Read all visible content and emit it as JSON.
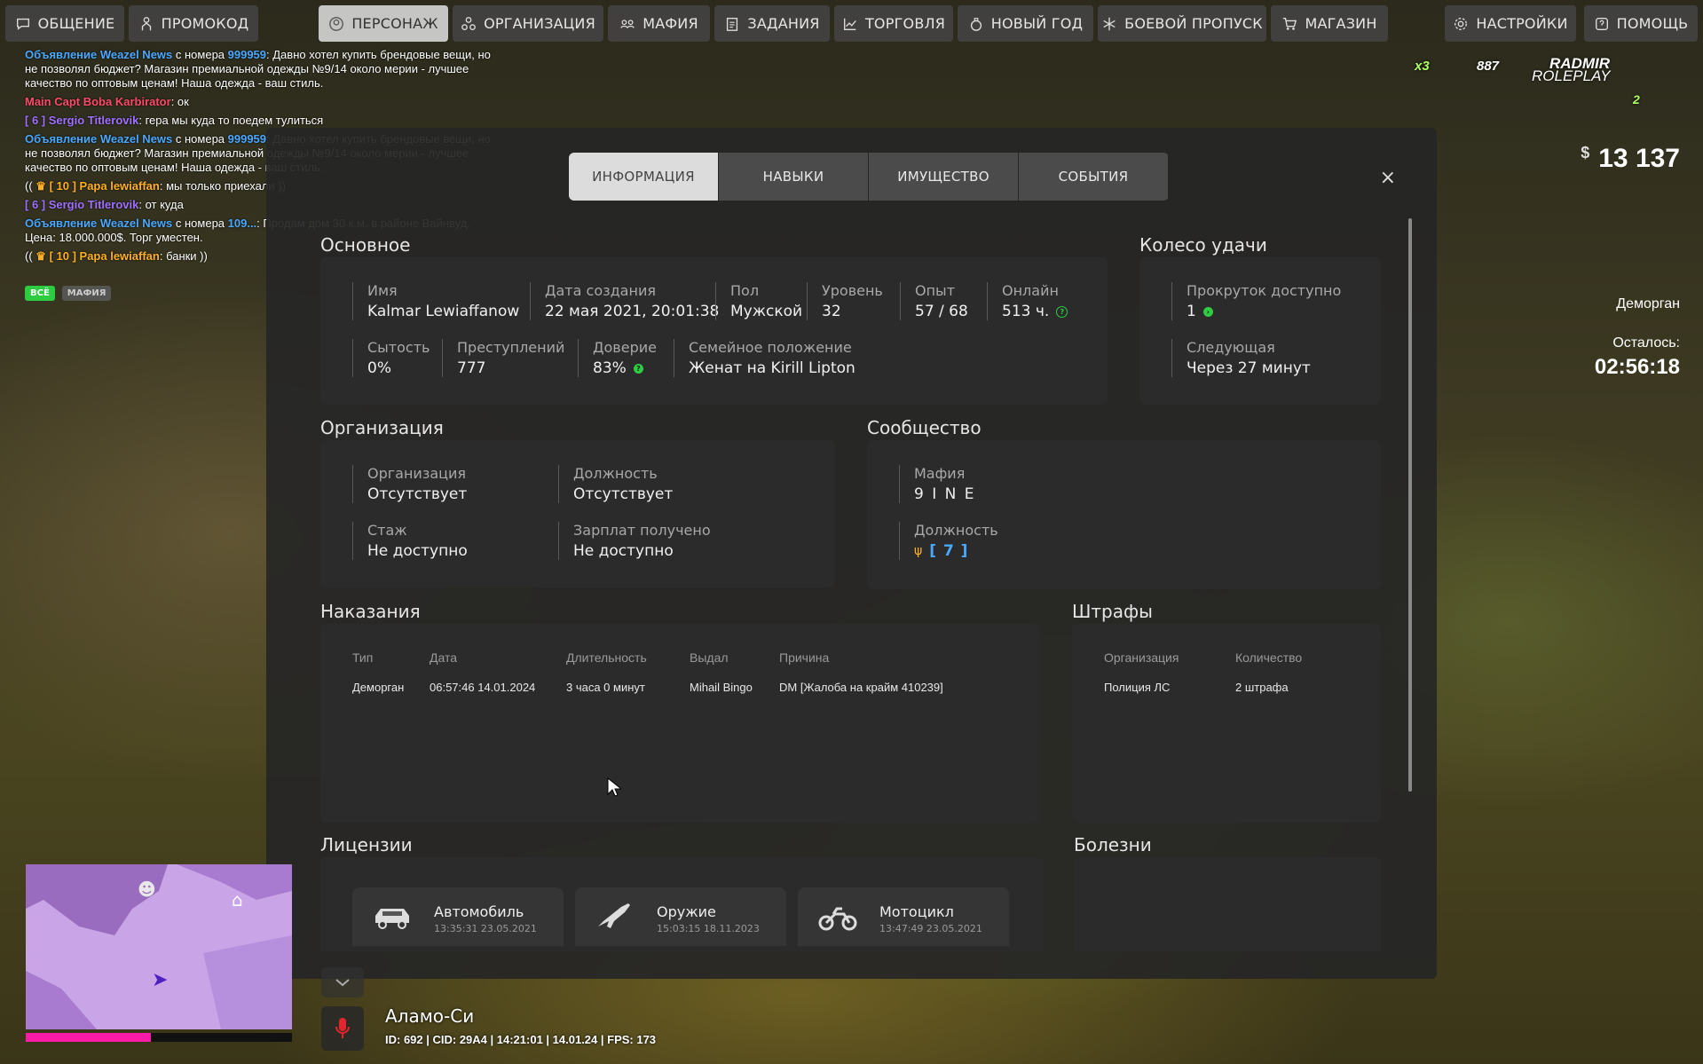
{
  "nav": {
    "left": [
      {
        "label": "ОБЩЕНИЕ",
        "icon": "chat-icon"
      },
      {
        "label": "ПРОМОКОД",
        "icon": "person-icon"
      },
      {
        "label": "ПЕРСОНАЖ",
        "icon": "user-circle-icon",
        "active": true
      },
      {
        "label": "ОРГАНИЗАЦИЯ",
        "icon": "network-icon"
      },
      {
        "label": "МАФИЯ",
        "icon": "group-icon"
      },
      {
        "label": "ЗАДАНИЯ",
        "icon": "clipboard-icon"
      },
      {
        "label": "ТОРГОВЛЯ",
        "icon": "chart-icon"
      },
      {
        "label": "НОВЫЙ ГОД",
        "icon": "ornament-icon"
      },
      {
        "label": "БОЕВОЙ ПРОПУСК",
        "icon": "snowflake-icon"
      },
      {
        "label": "МАГАЗИН",
        "icon": "cart-icon"
      }
    ],
    "right": [
      {
        "label": "НАСТРОЙКИ",
        "icon": "gear-icon"
      },
      {
        "label": "ПОМОЩЬ",
        "icon": "help-icon"
      }
    ]
  },
  "chat": {
    "lines": [
      {
        "prefix": "Объявление Weazel News",
        "mid": " с номера ",
        "num": "999959",
        "text": ": Давно хотел купить брендовые вещи, но не позволял бюджет? Магазин премиальной одежды №9/14 около мерии - лучшее качество по оптовым ценам! Наша одежда - ваш стиль."
      },
      {
        "name": "Main Capt Boba Karbirator",
        "text": ": ок",
        "color": "red"
      },
      {
        "name": "[ 6 ] Sergio Titlerovik",
        "text": ": гера мы куда то поедем тулиться",
        "color": "purple"
      },
      {
        "prefix": "Объявление Weazel News",
        "mid": " с номера ",
        "num": "999959",
        "text": ": Давно хотел купить брендовые вещи, но не позволял бюджет? Магазин премиальной одежды №9/14 около мерии - лучшее качество по оптовым ценам! Наша одежда - ваш стиль."
      },
      {
        "open": "((",
        "name": "[ 10 ] Papa lewiaffan",
        "text": ": мы только приехали ))",
        "color": "orange"
      },
      {
        "name": "[ 6 ] Sergio Titlerovik",
        "text": ": от куда",
        "color": "purple"
      },
      {
        "prefix": "Объявление Weazel News",
        "mid": " с номера ",
        "num": "109...",
        "text": ": Продам дом 30 к.м. в районе Вайнвуд. Цена: 18.000.000$. Торг уместен."
      },
      {
        "open": "((",
        "name": "[ 10 ] Papa lewiaffan",
        "text": ": банки ))",
        "color": "orange"
      }
    ],
    "tabs": [
      "ВСЁ",
      "МАФИЯ"
    ]
  },
  "hud": {
    "multiplier": "x3",
    "counter": "887",
    "brand_top": "RADMIR",
    "brand_bottom": "ROLEPLAY",
    "server_num": "2",
    "currency": "$",
    "money": "13 137",
    "event_name": "Деморган",
    "remain_label": "Осталось:",
    "remain_time": "02:56:18"
  },
  "modal": {
    "tabs": [
      "ИНФОРМАЦИЯ",
      "НАВЫКИ",
      "ИМУЩЕСТВО",
      "СОБЫТИЯ"
    ],
    "close": "×",
    "basic": {
      "title": "Основное",
      "name_label": "Имя",
      "name": "Kalmar Lewiaffanow",
      "created_label": "Дата создания",
      "created": "22 мая 2021, 20:01:38",
      "sex_label": "Пол",
      "sex": "Мужской",
      "level_label": "Уровень",
      "level": "32",
      "exp_label": "Опыт",
      "exp": "57 / 68",
      "online_label": "Онлайн",
      "online": "513 ч.",
      "satiety_label": "Сытость",
      "satiety": "0%",
      "crimes_label": "Преступлений",
      "crimes": "777",
      "trust_label": "Доверие",
      "trust": "83%",
      "family_label": "Семейное положение",
      "family": "Женат на Kirill Lipton"
    },
    "wheel": {
      "title": "Колесо удачи",
      "spins_label": "Прокруток доступно",
      "spins": "1",
      "next_label": "Следующая",
      "next": "Через 27 минут"
    },
    "org": {
      "title": "Организация",
      "org_label": "Организация",
      "org": "Отсутствует",
      "post_label": "Должность",
      "post": "Отсутствует",
      "exp_label": "Стаж",
      "exp": "Не доступно",
      "salary_label": "Зарплат получено",
      "salary": "Не доступно"
    },
    "community": {
      "title": "Сообщество",
      "mafia_label": "Мафия",
      "mafia": "9 I N E",
      "post_label": "Должность",
      "post": "[ 7 ]"
    },
    "punishments": {
      "title": "Наказания",
      "headers": [
        "Тип",
        "Дата",
        "Длительность",
        "Выдал",
        "Причина"
      ],
      "rows": [
        [
          "Деморган",
          "06:57:46 14.01.2024",
          "3 часа 0 минут",
          "Mihail Bingo",
          "DM [Жалоба на крайм 410239]"
        ]
      ]
    },
    "fines": {
      "title": "Штрафы",
      "headers": [
        "Организация",
        "Количество"
      ],
      "rows": [
        [
          "Полиция ЛС",
          "2 штрафа"
        ]
      ]
    },
    "licenses": {
      "title": "Лицензии",
      "items": [
        {
          "name": "Автомобиль",
          "date": "13:35:31 23.05.2021"
        },
        {
          "name": "Оружие",
          "date": "15:03:15 18.11.2023"
        },
        {
          "name": "Мотоцикл",
          "date": "13:47:49 23.05.2021"
        }
      ]
    },
    "diseases": {
      "title": "Болезни"
    }
  },
  "location": {
    "name": "Аламо-Си",
    "info": "ID: 692 | CID: 29A4 | 14:21:01   | 14.01.24   | FPS: 173"
  },
  "colors": {
    "accent_green": "#2ecc40",
    "accent_blue": "#4aa8ff",
    "minimap_bar": "#ff1aa8"
  }
}
